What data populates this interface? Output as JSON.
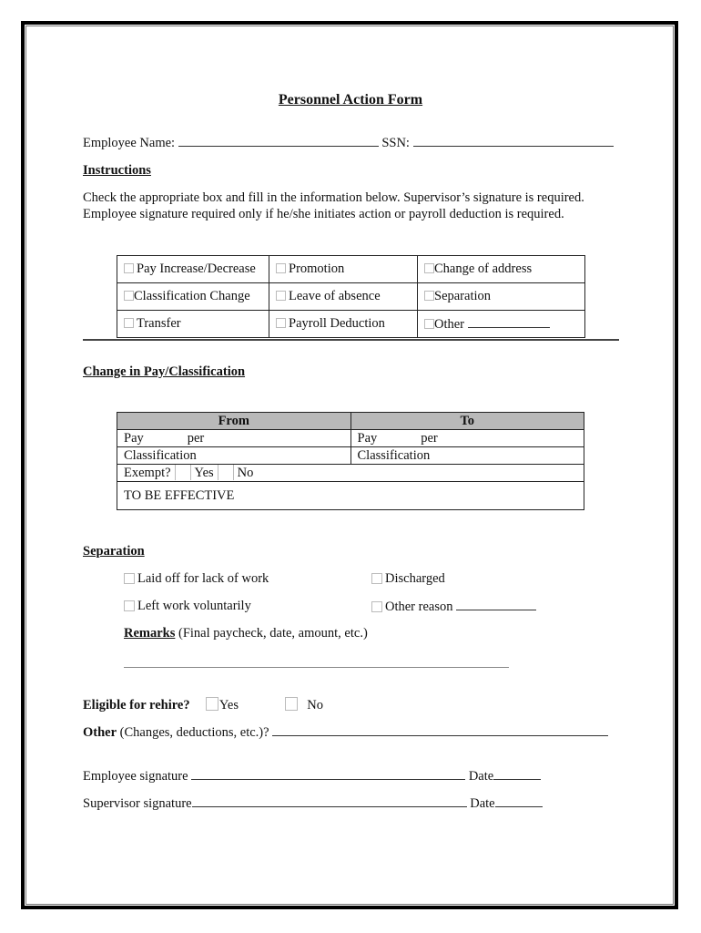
{
  "document": {
    "title": "Personnel Action Form",
    "employee_name_label": "Employee Name:",
    "ssn_label": "SSN:",
    "instructions_heading": "Instructions",
    "instructions_line1": "Check the appropriate box and fill in the information below.  Supervisor’s signature is required.",
    "instructions_line2": "Employee signature required only if he/she initiates action or payroll deduction is required."
  },
  "action_types": {
    "rows": [
      [
        "Pay Increase/Decrease",
        "Promotion",
        "Change of address"
      ],
      [
        "Classification Change",
        "Leave of absence",
        "Separation"
      ],
      [
        "Transfer",
        "Payroll Deduction",
        "Other"
      ]
    ],
    "checked": [
      [
        false,
        false,
        false
      ],
      [
        false,
        false,
        false
      ],
      [
        false,
        false,
        false
      ]
    ]
  },
  "pay_change": {
    "heading": "Change in Pay/Classification",
    "from_header": "From",
    "to_header": "To",
    "pay_label": "Pay",
    "per_label": "per",
    "classification_label": "Classification",
    "exempt_label": "Exempt?",
    "yes_label": "Yes",
    "no_label": "No",
    "effective_label": "TO BE EFFECTIVE"
  },
  "separation": {
    "heading": "Separation",
    "options": [
      "Laid off for lack of work",
      "Discharged",
      "Left work voluntarily",
      "Other reason"
    ],
    "remarks_label": "Remarks",
    "remarks_hint": "(Final paycheck, date, amount, etc.)"
  },
  "rehire": {
    "label": "Eligible for rehire?",
    "yes_label": "Yes",
    "no_label": "No"
  },
  "other": {
    "label": "Other",
    "hint": "(Changes, deductions, etc.)?"
  },
  "signatures": {
    "employee_label": "Employee signature",
    "supervisor_label": "Supervisor signature",
    "date_label": "Date"
  }
}
